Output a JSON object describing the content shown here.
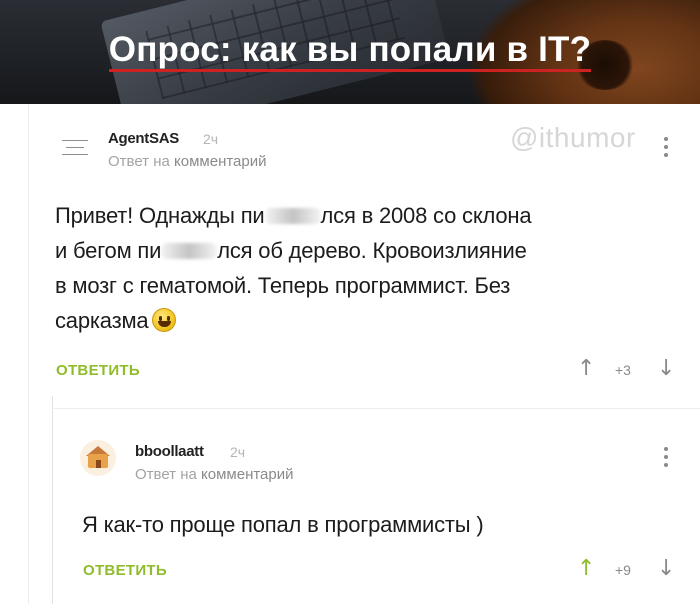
{
  "banner": {
    "title": "Опрос: как вы попали в IT?"
  },
  "watermark": "@ithumor",
  "comments": [
    {
      "author": "AgentSAS",
      "time": "2ч",
      "reply_to_prefix": "Ответ на",
      "reply_to_link": "комментарий",
      "text_lines": [
        [
          "Привет! Однажды пи",
          "лся в 2008 со склона"
        ],
        [
          "и бегом пи",
          "лся об дерево. Кровоизлияние"
        ],
        [
          "в мозг с гематомой. Теперь программист. Без"
        ],
        [
          "сарказма"
        ]
      ],
      "reply_label": "ОТВЕТИТЬ",
      "score": "+3"
    },
    {
      "author": "bboollaatt",
      "time": "2ч",
      "reply_to_prefix": "Ответ на",
      "reply_to_link": "комментарий",
      "text": "Я как-то проще попал в программисты )",
      "reply_label": "ОТВЕТИТЬ",
      "score": "+9"
    }
  ],
  "icons": {
    "menu": "menu-icon",
    "more": "kebab-icon",
    "vote_up": "arrow-up-icon",
    "vote_down": "arrow-down-icon",
    "emoji": "grinning-smiley-icon",
    "avatar": "house-avatar"
  },
  "colors": {
    "accent_green": "#8fbc2a",
    "title_underline": "#cc2222",
    "text": "#1c1c1c",
    "muted": "#a3a3a3"
  }
}
